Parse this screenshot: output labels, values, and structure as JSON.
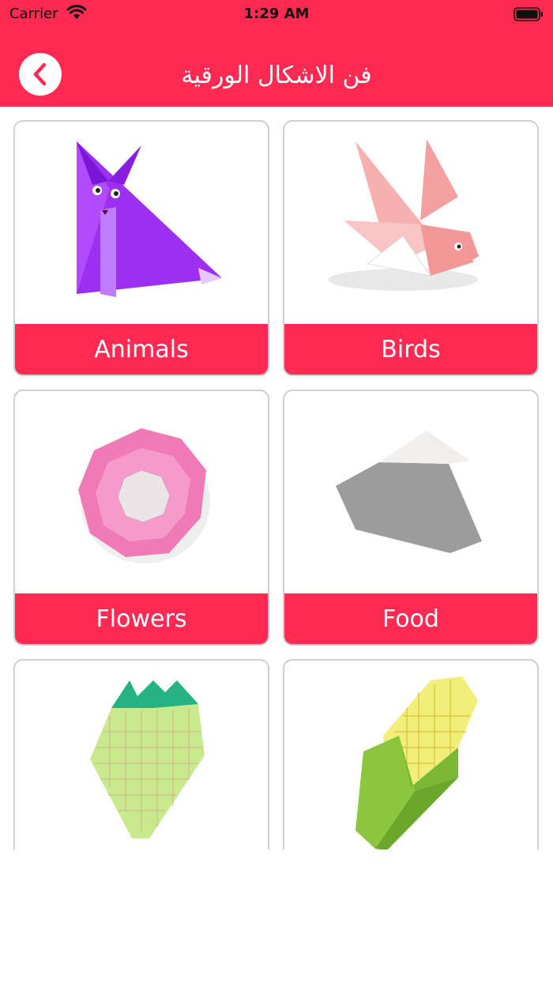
{
  "status": {
    "carrier": "Carrier",
    "time": "1:29 AM"
  },
  "header": {
    "title": "فن الاشكال الورقية"
  },
  "categories": [
    {
      "label": "Animals"
    },
    {
      "label": "Birds"
    },
    {
      "label": "Flowers"
    },
    {
      "label": "Food"
    },
    {
      "label": ""
    },
    {
      "label": ""
    }
  ],
  "colors": {
    "accent": "#ff2a52"
  }
}
